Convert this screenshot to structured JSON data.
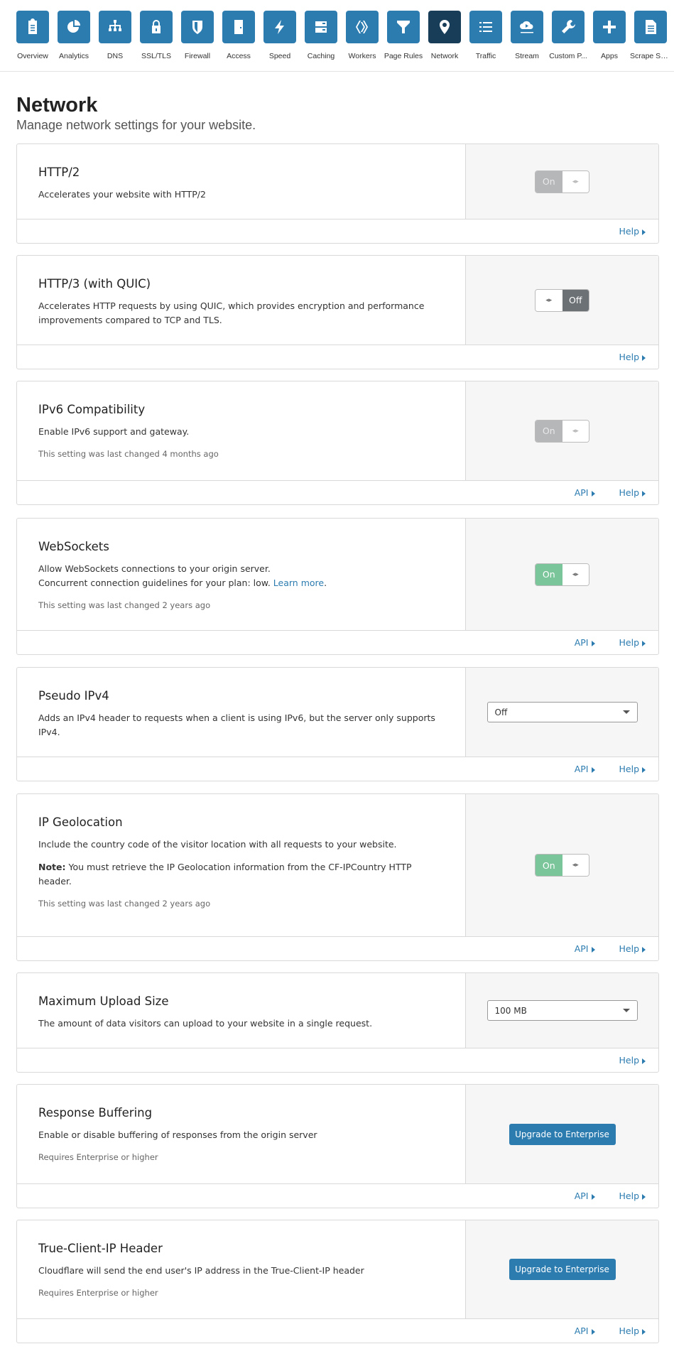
{
  "nav": [
    {
      "label": "Overview",
      "icon": "clipboard-icon"
    },
    {
      "label": "Analytics",
      "icon": "pie-chart-icon"
    },
    {
      "label": "DNS",
      "icon": "sitemap-icon"
    },
    {
      "label": "SSL/TLS",
      "icon": "lock-icon"
    },
    {
      "label": "Firewall",
      "icon": "shield-icon"
    },
    {
      "label": "Access",
      "icon": "door-icon"
    },
    {
      "label": "Speed",
      "icon": "lightning-icon"
    },
    {
      "label": "Caching",
      "icon": "server-icon"
    },
    {
      "label": "Workers",
      "icon": "workers-icon"
    },
    {
      "label": "Page Rules",
      "icon": "filter-icon"
    },
    {
      "label": "Network",
      "icon": "location-pin-icon",
      "active": true
    },
    {
      "label": "Traffic",
      "icon": "list-icon"
    },
    {
      "label": "Stream",
      "icon": "cloud-play-icon"
    },
    {
      "label": "Custom P...",
      "icon": "wrench-icon"
    },
    {
      "label": "Apps",
      "icon": "plus-icon"
    },
    {
      "label": "Scrape Shi...",
      "icon": "document-icon"
    }
  ],
  "page": {
    "title": "Network",
    "subtitle": "Manage network settings for your website."
  },
  "colors": {
    "accent": "#2c7cb0",
    "active_nav": "#173d59",
    "toggle_on": "#7ac59a",
    "toggle_off": "#6c7175",
    "toggle_disabled": "#b6b7b9"
  },
  "cards": [
    {
      "id": "http2",
      "title": "HTTP/2",
      "desc": [
        "Accelerates your website with HTTP/2"
      ],
      "control": {
        "type": "toggle",
        "state": "on-disabled",
        "label": "On"
      },
      "links": [
        "Help"
      ]
    },
    {
      "id": "http3",
      "title": "HTTP/3 (with QUIC)",
      "desc": [
        "Accelerates HTTP requests by using QUIC, which provides encryption and performance improvements compared to TCP and TLS."
      ],
      "control": {
        "type": "toggle",
        "state": "off",
        "label": "Off"
      },
      "links": [
        "Help"
      ]
    },
    {
      "id": "ipv6",
      "title": "IPv6 Compatibility",
      "desc": [
        "Enable IPv6 support and gateway."
      ],
      "note": "This setting was last changed 4 months ago",
      "control": {
        "type": "toggle",
        "state": "on-disabled",
        "label": "On"
      },
      "links": [
        "API",
        "Help"
      ]
    },
    {
      "id": "websockets",
      "title": "WebSockets",
      "desc": [
        "Allow WebSockets connections to your origin server.",
        "Concurrent connection guidelines for your plan: low. "
      ],
      "learn_more": "Learn more",
      "note": "This setting was last changed 2 years ago",
      "control": {
        "type": "toggle",
        "state": "on",
        "label": "On"
      },
      "links": [
        "API",
        "Help"
      ]
    },
    {
      "id": "pseudo-ipv4",
      "title": "Pseudo IPv4",
      "desc": [
        "Adds an IPv4 header to requests when a client is using IPv6, but the server only supports IPv4."
      ],
      "control": {
        "type": "select",
        "value": "Off"
      },
      "links": [
        "API",
        "Help"
      ]
    },
    {
      "id": "ip-geolocation",
      "title": "IP Geolocation",
      "desc": [
        "Include the country code of the visitor location with all requests to your website."
      ],
      "note_bold": "Note:",
      "note_text": " You must retrieve the IP Geolocation information from the CF-IPCountry HTTP header.",
      "note": "This setting was last changed 2 years ago",
      "control": {
        "type": "toggle",
        "state": "on",
        "label": "On"
      },
      "links": [
        "API",
        "Help"
      ]
    },
    {
      "id": "max-upload",
      "title": "Maximum Upload Size",
      "desc": [
        "The amount of data visitors can upload to your website in a single request."
      ],
      "control": {
        "type": "select",
        "value": "100 MB"
      },
      "links": [
        "Help"
      ]
    },
    {
      "id": "response-buffering",
      "title": "Response Buffering",
      "desc": [
        "Enable or disable buffering of responses from the origin server"
      ],
      "note": "Requires Enterprise or higher",
      "control": {
        "type": "button",
        "label": "Upgrade to Enterprise"
      },
      "links": [
        "API",
        "Help"
      ]
    },
    {
      "id": "true-client-ip",
      "title": "True-Client-IP Header",
      "desc": [
        "Cloudflare will send the end user's IP address in the True-Client-IP header"
      ],
      "note": "Requires Enterprise or higher",
      "control": {
        "type": "button",
        "label": "Upgrade to Enterprise"
      },
      "links": [
        "API",
        "Help"
      ]
    }
  ]
}
